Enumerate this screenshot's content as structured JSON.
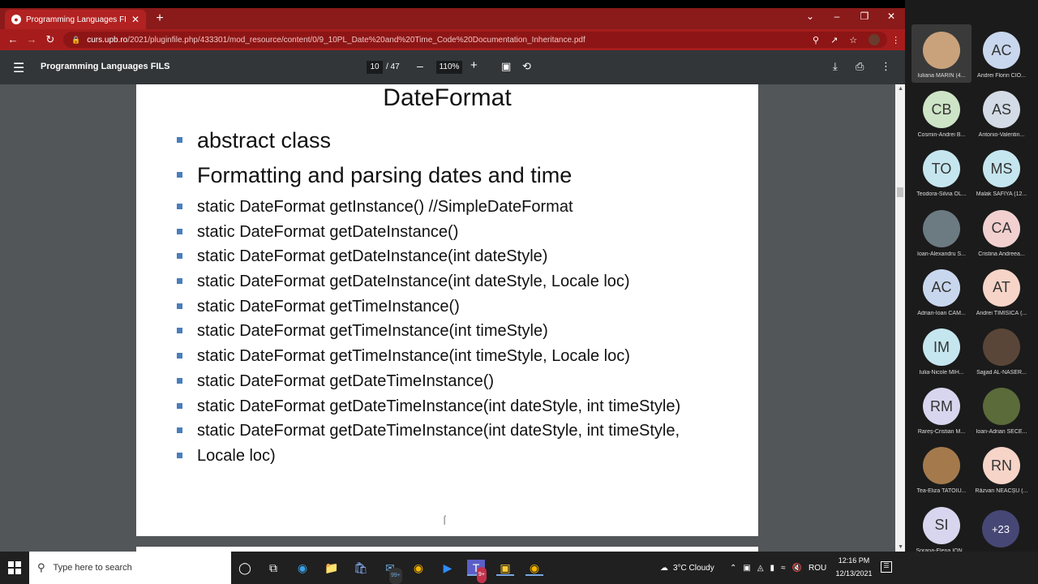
{
  "browser": {
    "tab_title": "Programming Languages FILS",
    "url_domain": "curs.upb.ro",
    "url_path": "/2021/pluginfile.php/433301/mod_resource/content/0/9_10PL_Date%20and%20Time_Code%20Documentation_Inheritance.pdf"
  },
  "pdf": {
    "title": "Programming Languages FILS",
    "current_page": "10",
    "page_of": "/  47",
    "zoom": "110%"
  },
  "slide": {
    "title": "DateFormat",
    "bullets": [
      {
        "text": "abstract class",
        "size": "big"
      },
      {
        "text": "Formatting and parsing dates and time",
        "size": "big"
      },
      {
        "text": "static DateFormat getInstance() //SimpleDateFormat",
        "size": "small"
      },
      {
        "text": "static DateFormat getDateInstance()",
        "size": "small"
      },
      {
        "text": "static DateFormat getDateInstance(int dateStyle)",
        "size": "small"
      },
      {
        "text": "static DateFormat getDateInstance(int dateStyle, Locale loc)",
        "size": "small"
      },
      {
        "text": "static DateFormat getTimeInstance()",
        "size": "small"
      },
      {
        "text": "static DateFormat getTimeInstance(int timeStyle)",
        "size": "small"
      },
      {
        "text": "static DateFormat getTimeInstance(int timeStyle, Locale loc)",
        "size": "small"
      },
      {
        "text": "static DateFormat getDateTimeInstance()",
        "size": "small"
      },
      {
        "text": "static DateFormat getDateTimeInstance(int dateStyle, int timeStyle)",
        "size": "small"
      },
      {
        "text": "static DateFormat getDateTimeInstance(int dateStyle, int timeStyle,",
        "size": "small"
      },
      {
        "text": "Locale loc)",
        "size": "small"
      }
    ]
  },
  "participants": [
    {
      "initials": "",
      "name": "Iuliana MARIN (4...",
      "photo": true,
      "bg": "#c9a27c",
      "active": true
    },
    {
      "initials": "AC",
      "name": "Andrei Florin CIO...",
      "photo": false,
      "bg": "#c9d7ee"
    },
    {
      "initials": "CB",
      "name": "Cosmin-Andrei B...",
      "photo": false,
      "bg": "#cde4c6"
    },
    {
      "initials": "AS",
      "name": "Antonio-Valentin...",
      "photo": false,
      "bg": "#d3dbe6"
    },
    {
      "initials": "TO",
      "name": "Teodora-Silvia OL...",
      "photo": false,
      "bg": "#c5e6ef"
    },
    {
      "initials": "MS",
      "name": "Malak SAFIYA (12...",
      "photo": false,
      "bg": "#c5e6ef"
    },
    {
      "initials": "",
      "name": "Ioan-Alexandru S...",
      "photo": true,
      "bg": "#6c7a82"
    },
    {
      "initials": "CA",
      "name": "Cristina Andreea...",
      "photo": false,
      "bg": "#f2d0d0"
    },
    {
      "initials": "AC",
      "name": "Adrian-Ioan CÂM...",
      "photo": false,
      "bg": "#c9d7ee"
    },
    {
      "initials": "AT",
      "name": "Andrei TIMISICĂ (...",
      "photo": false,
      "bg": "#f6d4c8"
    },
    {
      "initials": "IM",
      "name": "Iulia-Nicole MIH...",
      "photo": false,
      "bg": "#c5e6ef"
    },
    {
      "initials": "",
      "name": "Sajjad AL-NASER...",
      "photo": true,
      "bg": "#5a4638"
    },
    {
      "initials": "RM",
      "name": "Rareș-Cristian M...",
      "photo": false,
      "bg": "#d8d6ee"
    },
    {
      "initials": "",
      "name": "Ioan-Adrian SECE...",
      "photo": true,
      "bg": "#5b6b3a"
    },
    {
      "initials": "",
      "name": "Tea-Eliza TATOIU...",
      "photo": true,
      "bg": "#a47a4c"
    },
    {
      "initials": "RN",
      "name": "Răzvan NEACȘU (...",
      "photo": false,
      "bg": "#f6d4c8"
    },
    {
      "initials": "SI",
      "name": "Sorana-Elena ION...",
      "photo": false,
      "bg": "#d8d6ee"
    }
  ],
  "more_participants": "+23",
  "taskbar": {
    "search_placeholder": "Type here to search",
    "weather": "3°C  Cloudy",
    "language": "ROU",
    "time": "12:16 PM",
    "date": "12/13/2021",
    "mail_badge": "99+",
    "teams_badge": "9+"
  }
}
